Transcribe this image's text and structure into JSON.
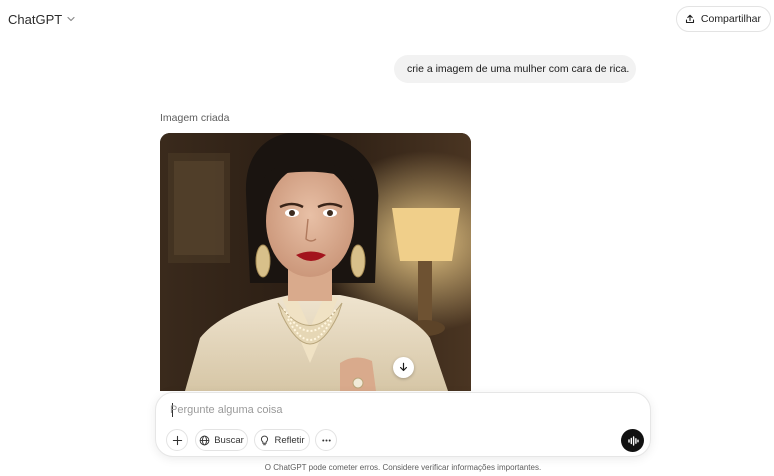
{
  "header": {
    "model_name": "ChatGPT",
    "share_label": "Compartilhar"
  },
  "conversation": {
    "user_message": "crie a imagem de uma mulher com cara de rica.",
    "image_caption": "Imagem criada"
  },
  "composer": {
    "placeholder": "Pergunte alguma coisa",
    "search_label": "Buscar",
    "think_label": "Refletir"
  },
  "footer": {
    "disclaimer": "O ChatGPT pode cometer erros. Considere verificar informações importantes."
  },
  "icons": {
    "chevron": "chevron-down-icon",
    "share": "upload-icon",
    "download": "download-arrow-icon",
    "plus": "plus-icon",
    "search": "globe-icon",
    "think": "lightbulb-icon",
    "more": "ellipsis-icon",
    "voice": "voice-waveform-icon"
  }
}
